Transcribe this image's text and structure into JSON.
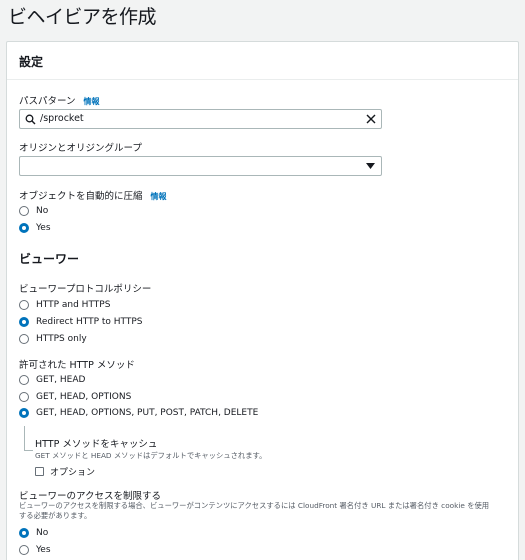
{
  "page": {
    "title": "ビヘイビアを作成"
  },
  "settings": {
    "heading": "設定",
    "path_pattern": {
      "label": "パスパターン",
      "info": "情報",
      "value": "/sprocket"
    },
    "origin": {
      "label": "オリジンとオリジングループ",
      "selected": ""
    },
    "compress": {
      "label": "オブジェクトを自動的に圧縮",
      "info": "情報",
      "options": [
        {
          "label": "No",
          "selected": false
        },
        {
          "label": "Yes",
          "selected": true
        }
      ]
    }
  },
  "viewer": {
    "heading": "ビューワー",
    "protocol_policy": {
      "label": "ビューワープロトコルポリシー",
      "options": [
        {
          "label": "HTTP and HTTPS",
          "selected": false
        },
        {
          "label": "Redirect HTTP to HTTPS",
          "selected": true
        },
        {
          "label": "HTTPS only",
          "selected": false
        }
      ]
    },
    "allowed_methods": {
      "label": "許可された HTTP メソッド",
      "options": [
        {
          "label": "GET, HEAD",
          "selected": false
        },
        {
          "label": "GET, HEAD, OPTIONS",
          "selected": false
        },
        {
          "label": "GET, HEAD, OPTIONS, PUT, POST, PATCH, DELETE",
          "selected": true
        }
      ]
    },
    "cache_methods": {
      "label": "HTTP メソッドをキャッシュ",
      "description": "GET メソッドと HEAD メソッドはデフォルトでキャッシュされます。",
      "option_label": "オプション",
      "checked": false
    },
    "restrict_access": {
      "label": "ビューワーのアクセスを制限する",
      "description_line1": "ビューワーのアクセスを制限する場合、ビューワーがコンテンツにアクセスするには CloudFront 署名付き URL または署名付き cookie を使用",
      "description_line2": "する必要があります。",
      "options": [
        {
          "label": "No",
          "selected": true
        },
        {
          "label": "Yes",
          "selected": false
        }
      ]
    }
  }
}
